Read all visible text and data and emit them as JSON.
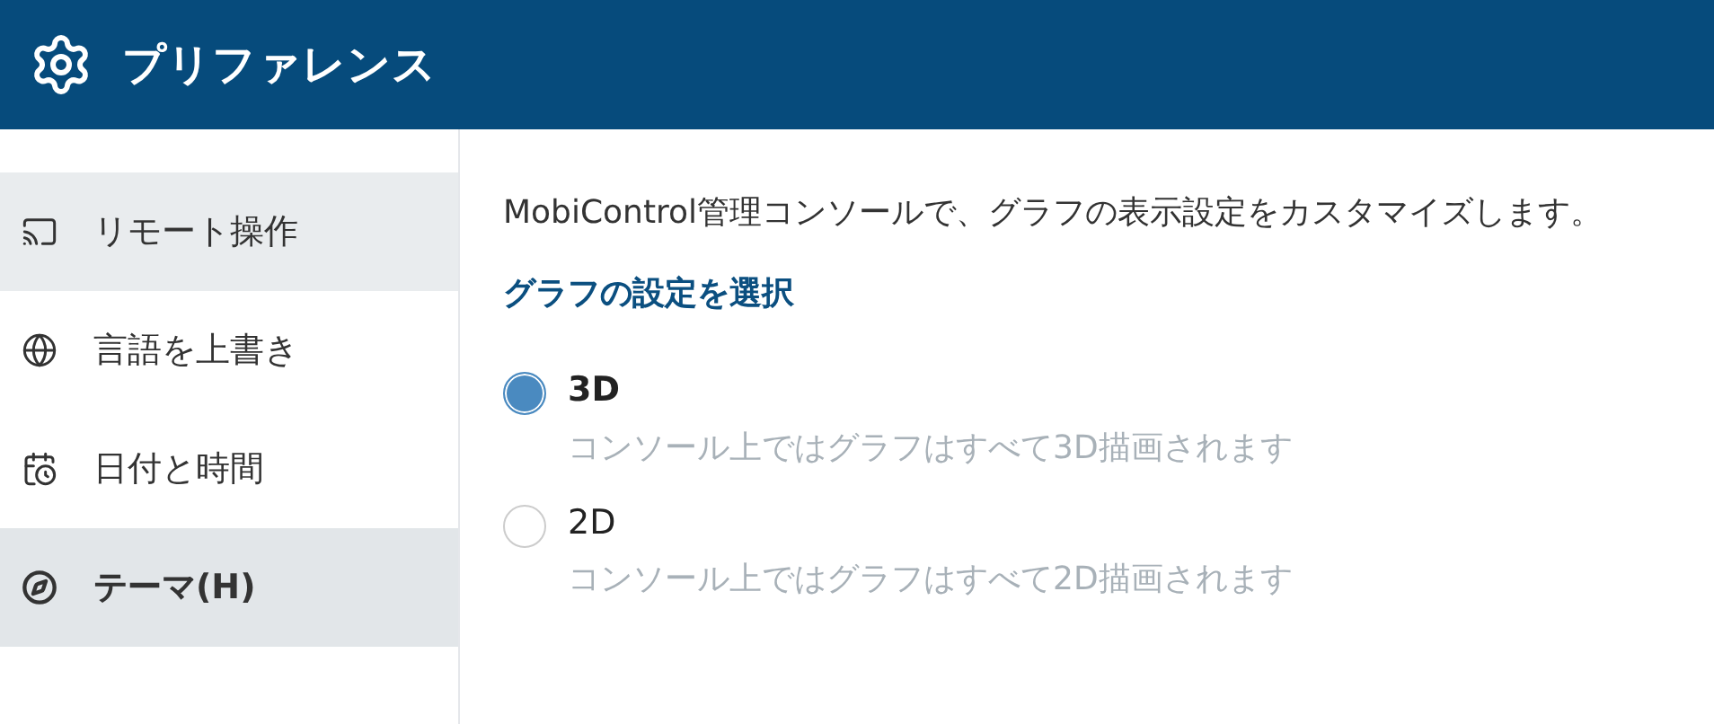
{
  "header": {
    "title": "プリファレンス"
  },
  "sidebar": {
    "items": [
      {
        "kind": "cast",
        "label": "リモート操作",
        "selected": false,
        "hovered": true
      },
      {
        "kind": "globe",
        "label": "言語を上書き",
        "selected": false,
        "hovered": false
      },
      {
        "kind": "calendar",
        "label": "日付と時間",
        "selected": false,
        "hovered": false
      },
      {
        "kind": "theme",
        "label": "テーマ(H)",
        "selected": true,
        "hovered": false
      }
    ]
  },
  "content": {
    "description": "MobiControl管理コンソールで、グラフの表示設定をカスタマイズします。",
    "section_title": "グラフの設定を選択",
    "options": [
      {
        "label": "3D",
        "description": "コンソール上ではグラフはすべて3D描画されます",
        "selected": true
      },
      {
        "label": "2D",
        "description": "コンソール上ではグラフはすべて2D描画されます",
        "selected": false
      }
    ]
  }
}
